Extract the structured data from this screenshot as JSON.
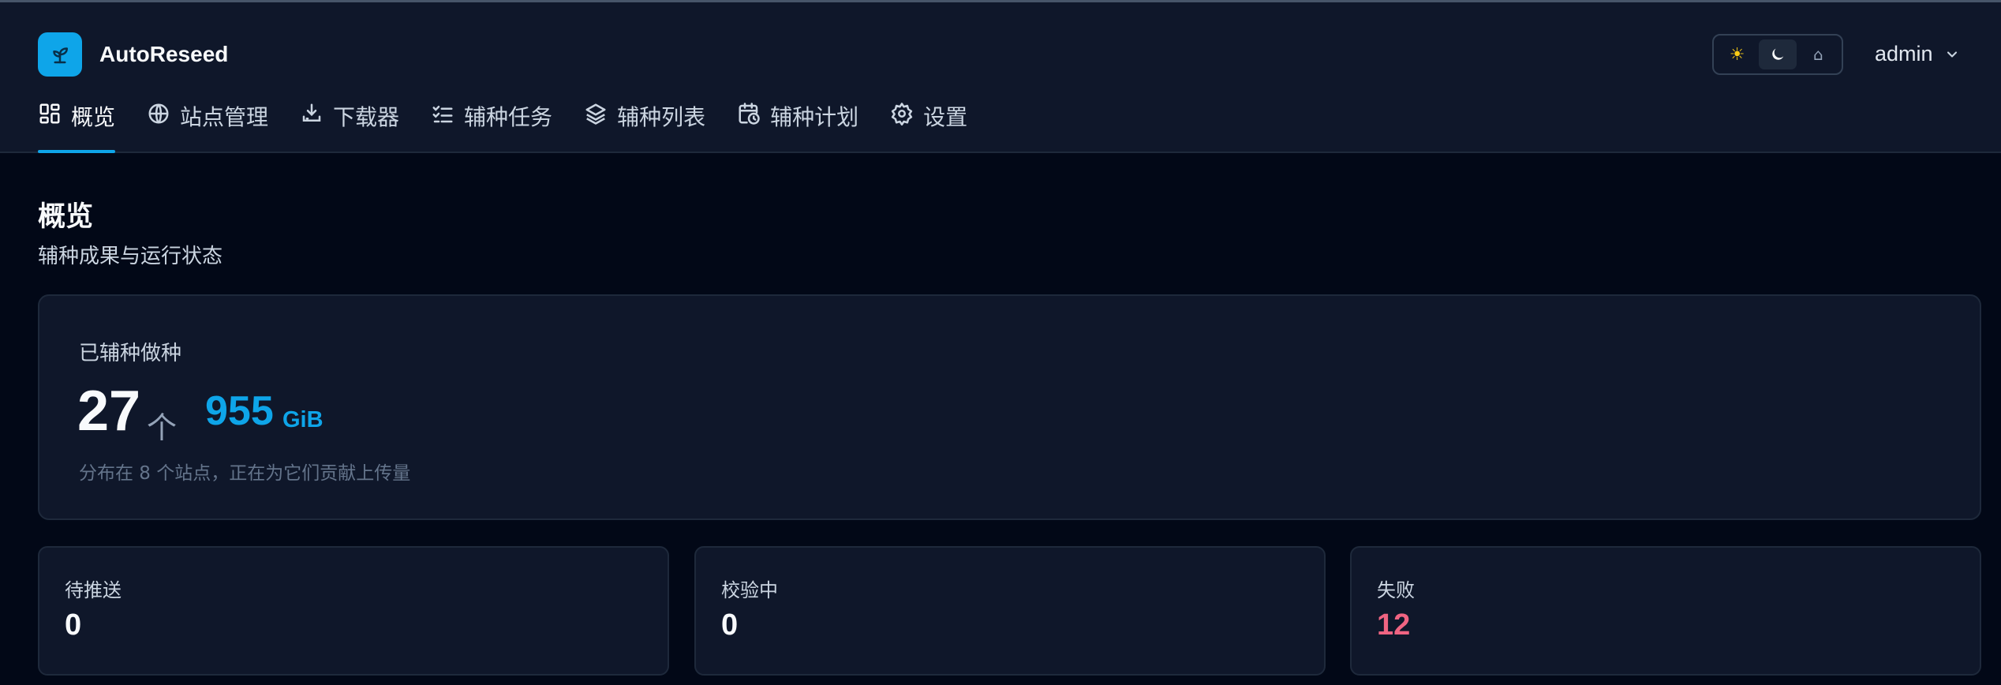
{
  "app": {
    "title": "AutoReseed",
    "user": "admin",
    "logo_icon": "sprout-icon"
  },
  "theme": {
    "options": [
      {
        "name": "light",
        "icon": "☀",
        "active": false
      },
      {
        "name": "dark",
        "icon": "moon-icon",
        "active": true
      },
      {
        "name": "system",
        "icon": "⌂",
        "active": false
      }
    ]
  },
  "nav": {
    "items": [
      {
        "label": "概览",
        "icon": "dashboard-icon",
        "active": true
      },
      {
        "label": "站点管理",
        "icon": "globe-icon",
        "active": false
      },
      {
        "label": "下载器",
        "icon": "download-icon",
        "active": false
      },
      {
        "label": "辅种任务",
        "icon": "checklist-icon",
        "active": false
      },
      {
        "label": "辅种列表",
        "icon": "layers-icon",
        "active": false
      },
      {
        "label": "辅种计划",
        "icon": "calendar-clock-icon",
        "active": false
      },
      {
        "label": "设置",
        "icon": "gear-icon",
        "active": false
      }
    ]
  },
  "page": {
    "title": "概览",
    "subtitle": "辅种成果与运行状态"
  },
  "hero": {
    "label": "已辅种做种",
    "count": "27",
    "count_unit": "个",
    "size": "955",
    "size_unit": "GiB",
    "description": "分布在 8 个站点，正在为它们贡献上传量"
  },
  "stats": [
    {
      "label": "待推送",
      "value": "0",
      "tone": "normal"
    },
    {
      "label": "校验中",
      "value": "0",
      "tone": "normal"
    },
    {
      "label": "失败",
      "value": "12",
      "tone": "danger"
    }
  ],
  "colors": {
    "accent": "#0ea5e9",
    "danger": "#f06482",
    "background": "#020817",
    "card": "#0f172a"
  }
}
